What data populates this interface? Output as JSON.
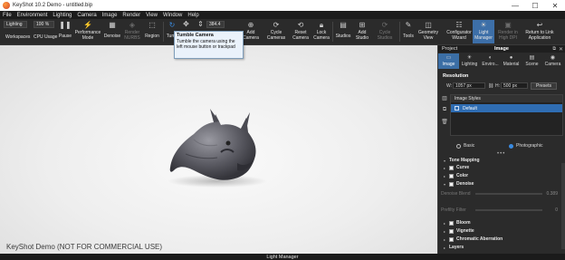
{
  "titlebar": {
    "title": "KeyShot 10.2 Demo  -  untitled.bip",
    "minimize": "—",
    "maximize": "☐",
    "close": "✕"
  },
  "menu": [
    "File",
    "Environment",
    "Lighting",
    "Camera",
    "Image",
    "Render",
    "View",
    "Window",
    "Help"
  ],
  "toolbar": {
    "lighting_select": "Lighting",
    "zoom_select": "100 %",
    "fps_value": "384.4",
    "workspaces": "Workspaces",
    "cpu_usage": "CPU Usage",
    "pause": "Pause",
    "performance_mode": "Performance Mode",
    "denoise": "Denoise",
    "render_nurbs": "Render NURBS",
    "region": "Region",
    "tumble": "Tumb",
    "add_camera": "Add Camera",
    "cycle_cameras": "Cycle Cameras",
    "reset_camera": "Reset Camera",
    "lock_camera": "Lock Camera",
    "studios": "Studios",
    "add_studio": "Add Studio",
    "cycle_studios": "Cycle Studios",
    "tools": "Tools",
    "geometry_view": "Geometry View",
    "configurator_wizard": "Configurator Wizard",
    "light_manager": "Light Manager",
    "render_high_dpi": "Render in High DPI",
    "return_link": "Return to Link Application"
  },
  "tooltip": {
    "title": "Tumble Camera",
    "body": "Tumble the camera using the left mouse button or trackpad"
  },
  "viewport": {
    "watermark": "KeyShot Demo (NOT FOR COMMERCIAL USE)"
  },
  "panel": {
    "left_title": "Project",
    "title": "Image",
    "tabs": [
      "Image",
      "Lighting",
      "Enviro...",
      "Material",
      "Scene",
      "Camera"
    ],
    "resolution_label": "Resolution",
    "width_label": "W:",
    "width_value": "1057 px",
    "height_label": "H:",
    "height_value": "500 px",
    "presets": "Presets",
    "styles_header": "Image Styles",
    "style_default": "Default",
    "mode_basic": "Basic",
    "mode_photographic": "Photographic",
    "dots": "•••",
    "tone_mapping": "Tone Mapping",
    "curve": "Curve",
    "color": "Color",
    "denoise": "Denoise",
    "denoise_blend": "Denoise Blend",
    "denoise_blend_value": "0.389",
    "prefilter": "Prefilty Filter",
    "prefilter_value": "0",
    "bloom": "Bloom",
    "vignette": "Vignette",
    "chromatic": "Chromatic Aberration",
    "layers": "Layers"
  },
  "bottombar": {
    "label": "Light Manager"
  },
  "colors": {
    "accent": "#3b6ea5",
    "selection": "#2f6db3"
  }
}
